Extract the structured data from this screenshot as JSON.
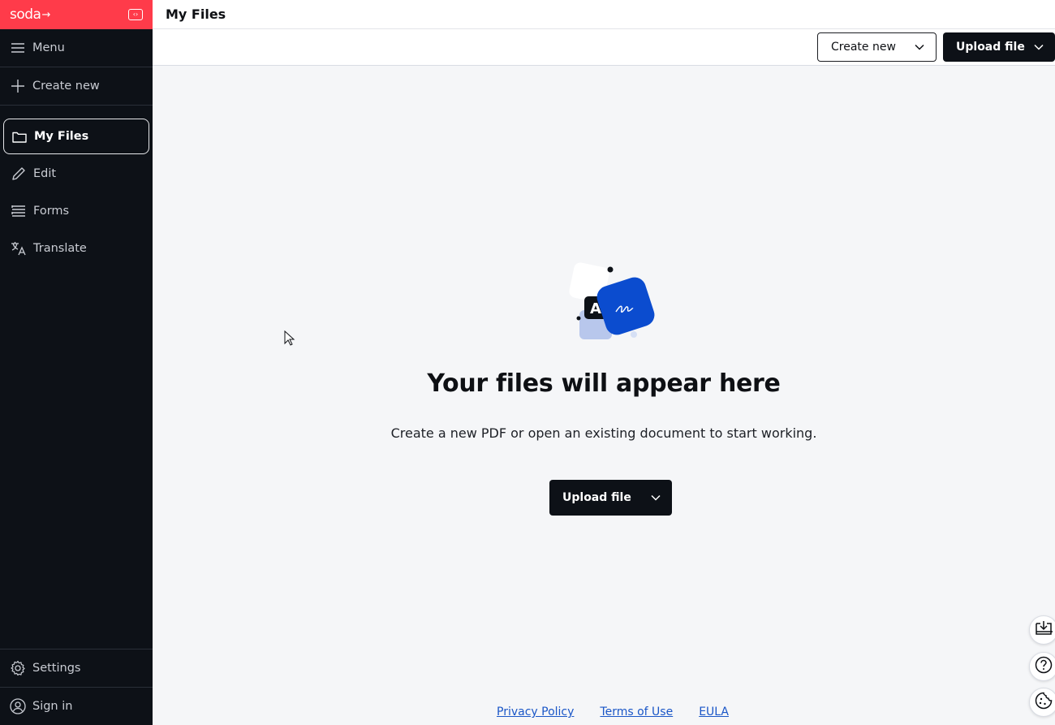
{
  "colors": {
    "brand": "#ff3b4a",
    "sidebar_bg": "#0d1117",
    "link": "#1a56c7",
    "main_bg": "#f5f6f8"
  },
  "sidebar": {
    "logo": "soda",
    "menu_label": "Menu",
    "create_new_label": "Create new",
    "items": [
      {
        "label": "My Files",
        "icon": "folder-icon",
        "active": true
      },
      {
        "label": "Edit",
        "icon": "pencil-icon"
      },
      {
        "label": "Forms",
        "icon": "forms-icon"
      },
      {
        "label": "Translate",
        "icon": "translate-icon"
      }
    ],
    "settings_label": "Settings",
    "signin_label": "Sign in"
  },
  "header": {
    "title": "My Files",
    "create_new_label": "Create new",
    "upload_label": "Upload file"
  },
  "empty_state": {
    "title": "Your files will appear here",
    "subtitle": "Create a new PDF or open an existing document to start working.",
    "upload_label": "Upload file"
  },
  "footer": {
    "links": [
      "Privacy Policy",
      "Terms of Use",
      "EULA"
    ]
  }
}
